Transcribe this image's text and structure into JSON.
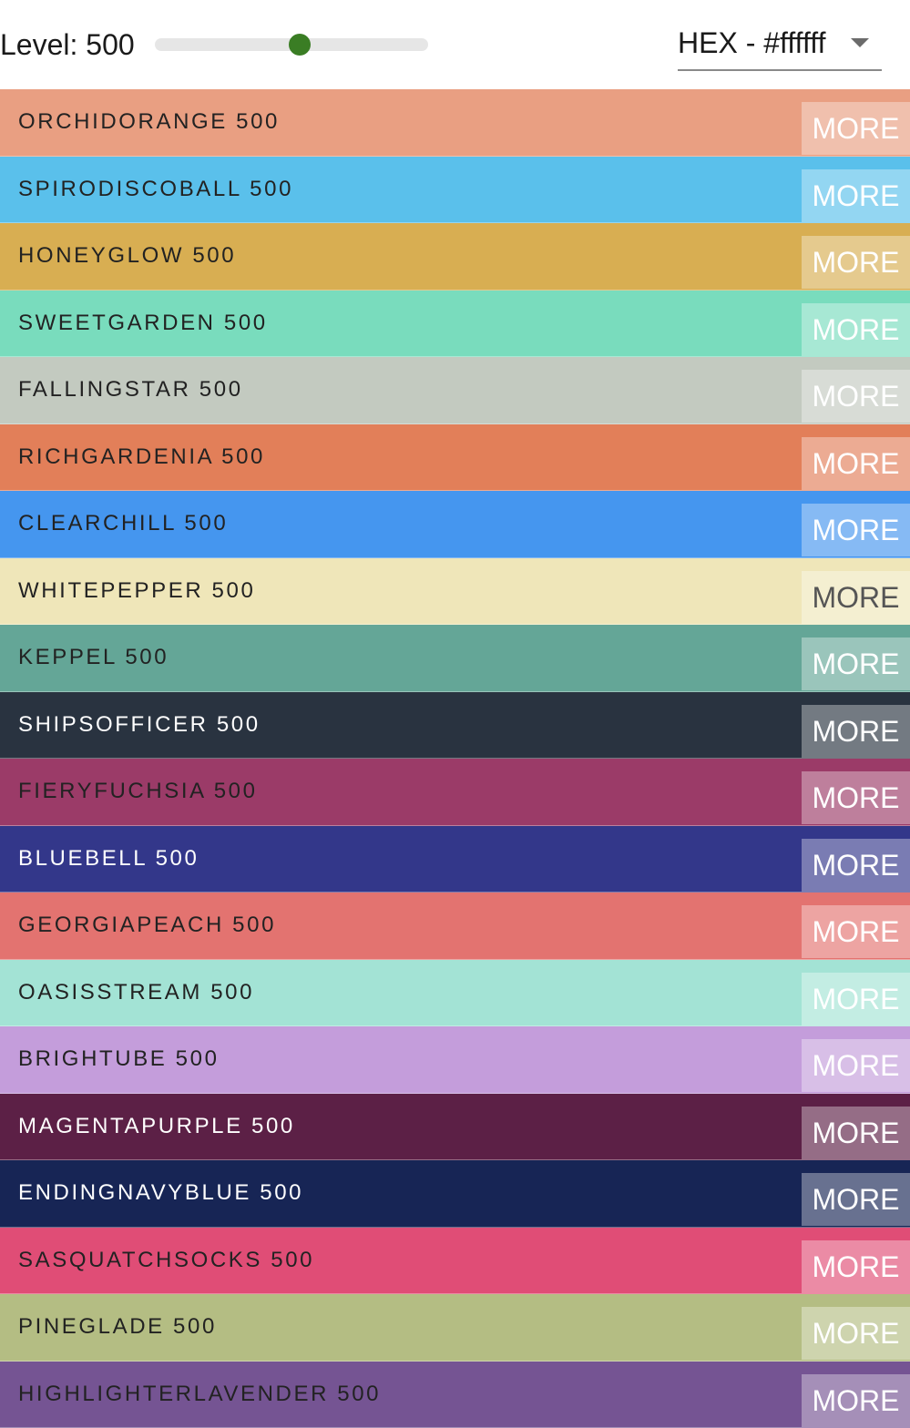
{
  "toolbar": {
    "level_label": "Level: 500",
    "level_value": 500,
    "level_min": 50,
    "level_max": 900,
    "accent_color": "#3a7d24",
    "format_label": "HEX - #ffffff"
  },
  "rows": [
    {
      "name": "ORCHIDORANGE 500",
      "color": "#e99f82",
      "text_color": "#222222",
      "more_label": "MORE",
      "more_text_color": "#ffffff"
    },
    {
      "name": "SPIRODISCOBALL 500",
      "color": "#5ac0eb",
      "text_color": "#222222",
      "more_label": "MORE",
      "more_text_color": "#ffffff"
    },
    {
      "name": "HONEYGLOW 500",
      "color": "#d8ae52",
      "text_color": "#222222",
      "more_label": "MORE",
      "more_text_color": "#ffffff"
    },
    {
      "name": "SWEETGARDEN 500",
      "color": "#79dcbd",
      "text_color": "#222222",
      "more_label": "MORE",
      "more_text_color": "#ffffff"
    },
    {
      "name": "FALLINGSTAR 500",
      "color": "#c3cac0",
      "text_color": "#222222",
      "more_label": "MORE",
      "more_text_color": "#ffffff"
    },
    {
      "name": "RICHGARDENIA 500",
      "color": "#e27f59",
      "text_color": "#222222",
      "more_label": "MORE",
      "more_text_color": "#ffffff"
    },
    {
      "name": "CLEARCHILL 500",
      "color": "#4596ef",
      "text_color": "#222222",
      "more_label": "MORE",
      "more_text_color": "#ffffff"
    },
    {
      "name": "WHITEPEPPER 500",
      "color": "#efe6b9",
      "text_color": "#222222",
      "more_label": "MORE",
      "more_text_color": "#555555"
    },
    {
      "name": "KEPPEL 500",
      "color": "#64a697",
      "text_color": "#222222",
      "more_label": "MORE",
      "more_text_color": "#ffffff"
    },
    {
      "name": "SHIPSOFFICER 500",
      "color": "#293340",
      "text_color": "#ffffff",
      "more_label": "MORE",
      "more_text_color": "#ffffff"
    },
    {
      "name": "FIERYFUCHSIA 500",
      "color": "#9b3b68",
      "text_color": "#222222",
      "more_label": "MORE",
      "more_text_color": "#ffffff"
    },
    {
      "name": "BLUEBELL 500",
      "color": "#33378a",
      "text_color": "#ffffff",
      "more_label": "MORE",
      "more_text_color": "#ffffff"
    },
    {
      "name": "GEORGIAPEACH 500",
      "color": "#e37370",
      "text_color": "#222222",
      "more_label": "MORE",
      "more_text_color": "#ffffff"
    },
    {
      "name": "OASISSTREAM 500",
      "color": "#a3e3d5",
      "text_color": "#222222",
      "more_label": "MORE",
      "more_text_color": "#ffffff"
    },
    {
      "name": "BRIGHTUBE 500",
      "color": "#c49ddb",
      "text_color": "#222222",
      "more_label": "MORE",
      "more_text_color": "#ffffff"
    },
    {
      "name": "MAGENTAPURPLE 500",
      "color": "#5c2046",
      "text_color": "#ffffff",
      "more_label": "MORE",
      "more_text_color": "#ffffff"
    },
    {
      "name": "ENDINGNAVYBLUE 500",
      "color": "#172555",
      "text_color": "#ffffff",
      "more_label": "MORE",
      "more_text_color": "#ffffff"
    },
    {
      "name": "SASQUATCHSOCKS 500",
      "color": "#e04d76",
      "text_color": "#222222",
      "more_label": "MORE",
      "more_text_color": "#ffffff"
    },
    {
      "name": "PINEGLADE 500",
      "color": "#b4bd83",
      "text_color": "#222222",
      "more_label": "MORE",
      "more_text_color": "#ffffff"
    },
    {
      "name": "HIGHLIGHTERLAVENDER 500",
      "color": "#755493",
      "text_color": "#222222",
      "more_label": "MORE",
      "more_text_color": "#ffffff"
    }
  ]
}
